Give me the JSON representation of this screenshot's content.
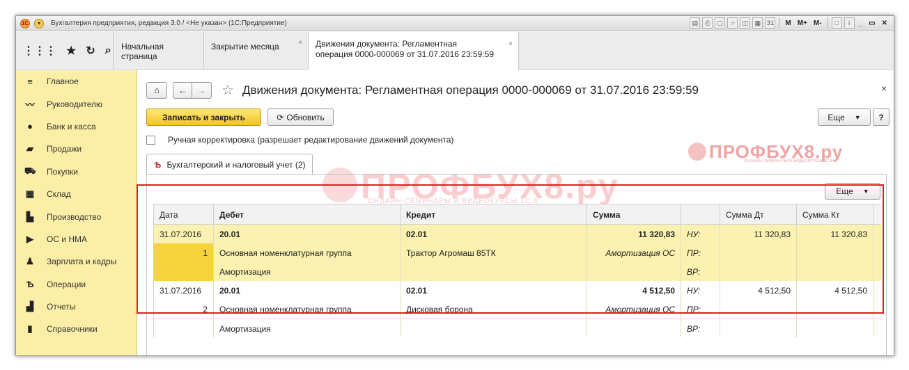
{
  "window": {
    "title": "Бухгалтерия предприятия, редакция 3.0 / <Не указан> (1С:Предприятие)",
    "tools": [
      "M",
      "M+",
      "M-"
    ]
  },
  "tabs": [
    {
      "label": "Начальная страница",
      "closable": false
    },
    {
      "label": "Закрытие месяца",
      "closable": true
    },
    {
      "label": "Движения документа: Регламентная",
      "label2": "операция 0000-000069 от 31.07.2016 23:59:59",
      "closable": true,
      "active": true
    }
  ],
  "sidebar": {
    "items": [
      {
        "label": "Главное",
        "icon": "menu-icon"
      },
      {
        "label": "Руководителю",
        "icon": "trend-icon"
      },
      {
        "label": "Банк и касса",
        "icon": "coin-icon"
      },
      {
        "label": "Продажи",
        "icon": "bag-icon"
      },
      {
        "label": "Покупки",
        "icon": "cart-icon"
      },
      {
        "label": "Склад",
        "icon": "grid-icon"
      },
      {
        "label": "Производство",
        "icon": "factory-icon"
      },
      {
        "label": "ОС и НМА",
        "icon": "truck-icon"
      },
      {
        "label": "Зарплата и кадры",
        "icon": "person-icon"
      },
      {
        "label": "Операции",
        "icon": "operations-icon"
      },
      {
        "label": "Отчеты",
        "icon": "bar-chart-icon"
      },
      {
        "label": "Справочники",
        "icon": "book-icon"
      }
    ]
  },
  "header": {
    "title": "Движения документа: Регламентная операция 0000-000069 от 31.07.2016 23:59:59"
  },
  "toolbar": {
    "save_close": "Записать и закрыть",
    "refresh": "Обновить",
    "more": "Еще",
    "help": "?"
  },
  "manual_edit": {
    "label": "Ручная корректировка (разрешает редактирование движений документа)"
  },
  "subtab": {
    "label": "Бухгалтерский и налоговый учет (2)"
  },
  "panel": {
    "more": "Еще"
  },
  "watermark": {
    "text": "ПРОФБУХ8.ру",
    "sub_small": "ОНЛАЙН-СЕМИНАРЫ И ВИДЕОКУРСЫ 1С:8",
    "sub_large": "ОНЛАЙН-СЕМИНАРЫ И ВИДЕОКУРСЫ 1С:8"
  },
  "table": {
    "columns": [
      "Дата",
      "Дебет",
      "Кредит",
      "Сумма",
      "",
      "Сумма Дт",
      "Сумма Кт"
    ],
    "entries": [
      {
        "date": "31.07.2016",
        "num": "1",
        "debit": "20.01",
        "debit_sub1": "Основная номенклатурная группа",
        "debit_sub2": "Амортизация",
        "credit": "02.01",
        "credit_sub1": "Трактор Агромаш 85ТК",
        "sum": "11 320,83",
        "sum_note": "Амортизация ОС",
        "nu": "НУ:",
        "pr": "ПР:",
        "vr": "ВР:",
        "sum_dt": "11 320,83",
        "sum_kt": "11 320,83"
      },
      {
        "date": "31.07.2016",
        "num": "2",
        "debit": "20.01",
        "debit_sub1": "Основная номенклатурная группа",
        "debit_sub2": "Амортизация",
        "credit": "02.01",
        "credit_sub1": "Дисковая борона",
        "sum": "4 512,50",
        "sum_note": "Амортизация ОС",
        "nu": "НУ:",
        "pr": "ПР:",
        "vr": "ВР:",
        "sum_dt": "4 512,50",
        "sum_kt": "4 512,50"
      }
    ]
  }
}
